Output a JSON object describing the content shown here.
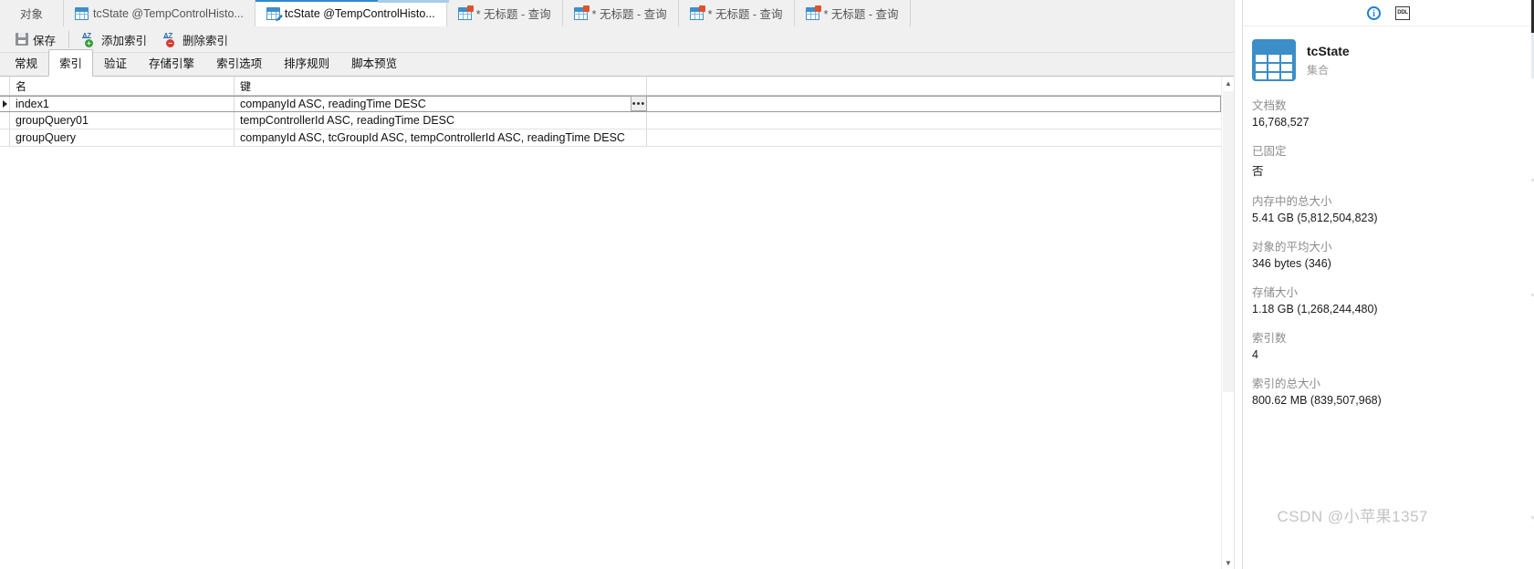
{
  "tabs": [
    {
      "label": "对象",
      "icon": "none",
      "state": "plain"
    },
    {
      "label": "tcState @TempControlHisto...",
      "icon": "grid-icon",
      "state": "plain"
    },
    {
      "label": "tcState @TempControlHisto...",
      "icon": "grid-edit-icon",
      "state": "active"
    },
    {
      "label": "* 无标题 - 查询",
      "icon": "query-icon",
      "state": "plain"
    },
    {
      "label": "* 无标题 - 查询",
      "icon": "query-icon",
      "state": "plain"
    },
    {
      "label": "* 无标题 - 查询",
      "icon": "query-icon",
      "state": "plain"
    },
    {
      "label": "* 无标题 - 查询",
      "icon": "query-icon",
      "state": "plain"
    }
  ],
  "toolbar": {
    "save_label": "保存",
    "add_index_label": "添加索引",
    "delete_index_label": "删除索引"
  },
  "subtabs": [
    {
      "label": "常规",
      "active": false
    },
    {
      "label": "索引",
      "active": true
    },
    {
      "label": "验证",
      "active": false
    },
    {
      "label": "存储引擎",
      "active": false
    },
    {
      "label": "索引选项",
      "active": false
    },
    {
      "label": "排序规则",
      "active": false
    },
    {
      "label": "脚本预览",
      "active": false
    }
  ],
  "grid": {
    "columns": [
      "名",
      "键"
    ],
    "rows": [
      {
        "name": "index1",
        "key": "companyId ASC, readingTime DESC",
        "selected": true
      },
      {
        "name": "groupQuery01",
        "key": "tempControllerId ASC, readingTime DESC",
        "selected": false
      },
      {
        "name": "groupQuery",
        "key": "companyId ASC, tcGroupId ASC, tempControllerId ASC, readingTime DESC",
        "selected": false
      }
    ],
    "ellipsis_label": "•••"
  },
  "info_panel": {
    "info_icon_label": "i",
    "ddl_icon_label": "DDL",
    "object_name": "tcState",
    "object_type": "集合",
    "stats": [
      {
        "key": "文档数",
        "value": "16,768,527"
      },
      {
        "key": "已固定",
        "value": "否"
      },
      {
        "key": "内存中的总大小",
        "value": "5.41 GB (5,812,504,823)"
      },
      {
        "key": "对象的平均大小",
        "value": "346 bytes (346)"
      },
      {
        "key": "存储大小",
        "value": "1.18 GB (1,268,244,480)"
      },
      {
        "key": "索引数",
        "value": "4"
      },
      {
        "key": "索引的总大小",
        "value": "800.62 MB (839,507,968)"
      }
    ]
  },
  "watermark": "CSDN @小苹果1357",
  "colors": {
    "accent": "#2d8ad4",
    "icon_blue": "#3b8ec8",
    "plus_green": "#36a039",
    "minus_red": "#d53a2c"
  }
}
